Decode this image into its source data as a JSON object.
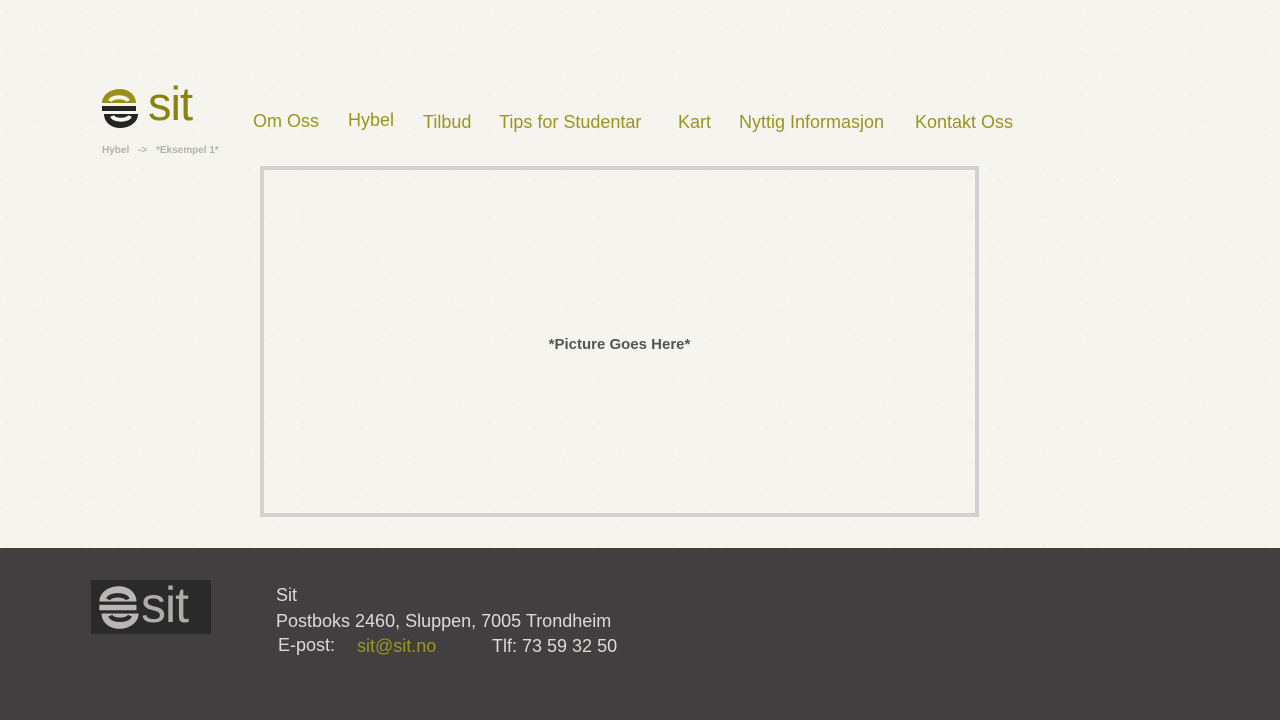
{
  "header": {
    "logo_text": "sit",
    "logo_icon": "sit-swirl-logo-icon",
    "brand_color": "#8a8212",
    "nav": [
      {
        "label": "Om Oss"
      },
      {
        "label": "Hybel"
      },
      {
        "label": "Tilbud"
      },
      {
        "label": "Tips for Studentar"
      },
      {
        "label": "Kart"
      },
      {
        "label": "Nyttig Informasjon"
      },
      {
        "label": "Kontakt Oss"
      }
    ]
  },
  "breadcrumb": {
    "parent": "Hybel",
    "separator": "->",
    "current": "*Eksempel 1*"
  },
  "main": {
    "picture_placeholder": "*Picture Goes Here*"
  },
  "footer": {
    "logo_text": "sit",
    "logo_icon": "sit-swirl-logo-icon",
    "name": "Sit",
    "address": "Postboks 2460, Sluppen, 7005 Trondheim",
    "email_label": "E-post:",
    "email": "sit@sit.no",
    "phone": "Tlf: 73 59 32 50",
    "background_color": "#423f40"
  }
}
